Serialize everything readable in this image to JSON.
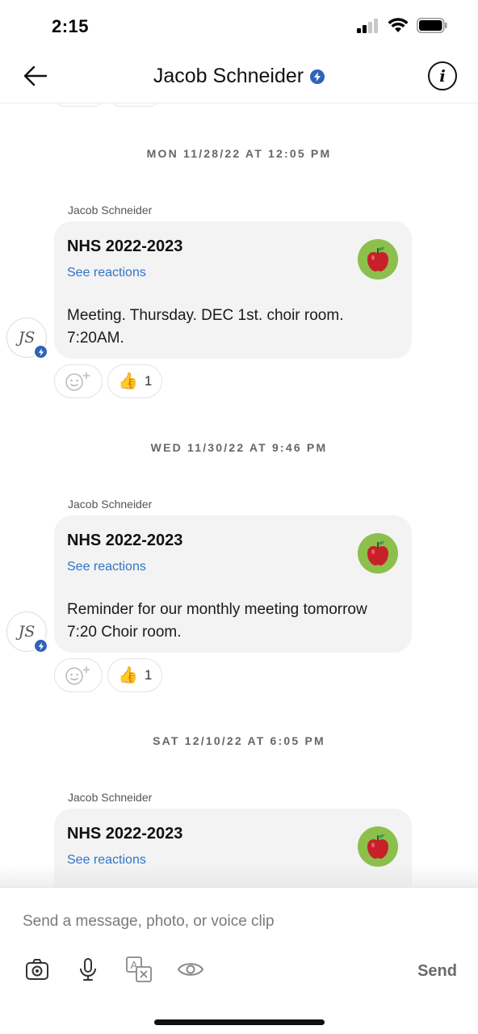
{
  "status_bar": {
    "time": "2:15"
  },
  "header": {
    "title": "Jacob Schneider"
  },
  "messages": [
    {
      "date": "MON 11/28/22 AT 12:05 PM",
      "sender": "Jacob Schneider",
      "class_name": "NHS 2022-2023",
      "see_reactions": "See reactions",
      "body": "Meeting. Thursday. DEC 1st. choir room. 7:20AM.",
      "avatar_initials": "JS",
      "thumbs_count": "1"
    },
    {
      "date": "WED 11/30/22 AT 9:46 PM",
      "sender": "Jacob Schneider",
      "class_name": "NHS 2022-2023",
      "see_reactions": "See reactions",
      "body": "Reminder for our monthly meeting tomorrow 7:20 Choir room.",
      "avatar_initials": "JS",
      "thumbs_count": "1"
    },
    {
      "date": "SAT 12/10/22 AT 6:05 PM",
      "sender": "Jacob Schneider",
      "class_name": "NHS 2022-2023",
      "see_reactions": "See reactions"
    }
  ],
  "composer": {
    "placeholder": "Send a message, photo, or voice clip",
    "send_label": "Send",
    "tools": [
      "camera-icon",
      "microphone-icon",
      "translate-icon",
      "eye-icon"
    ]
  },
  "colors": {
    "accent_blue": "#2f63b8",
    "link_blue": "#2f74c8",
    "bubble_bg": "#f3f3f3",
    "class_avatar_bg": "#8cbf4c"
  }
}
